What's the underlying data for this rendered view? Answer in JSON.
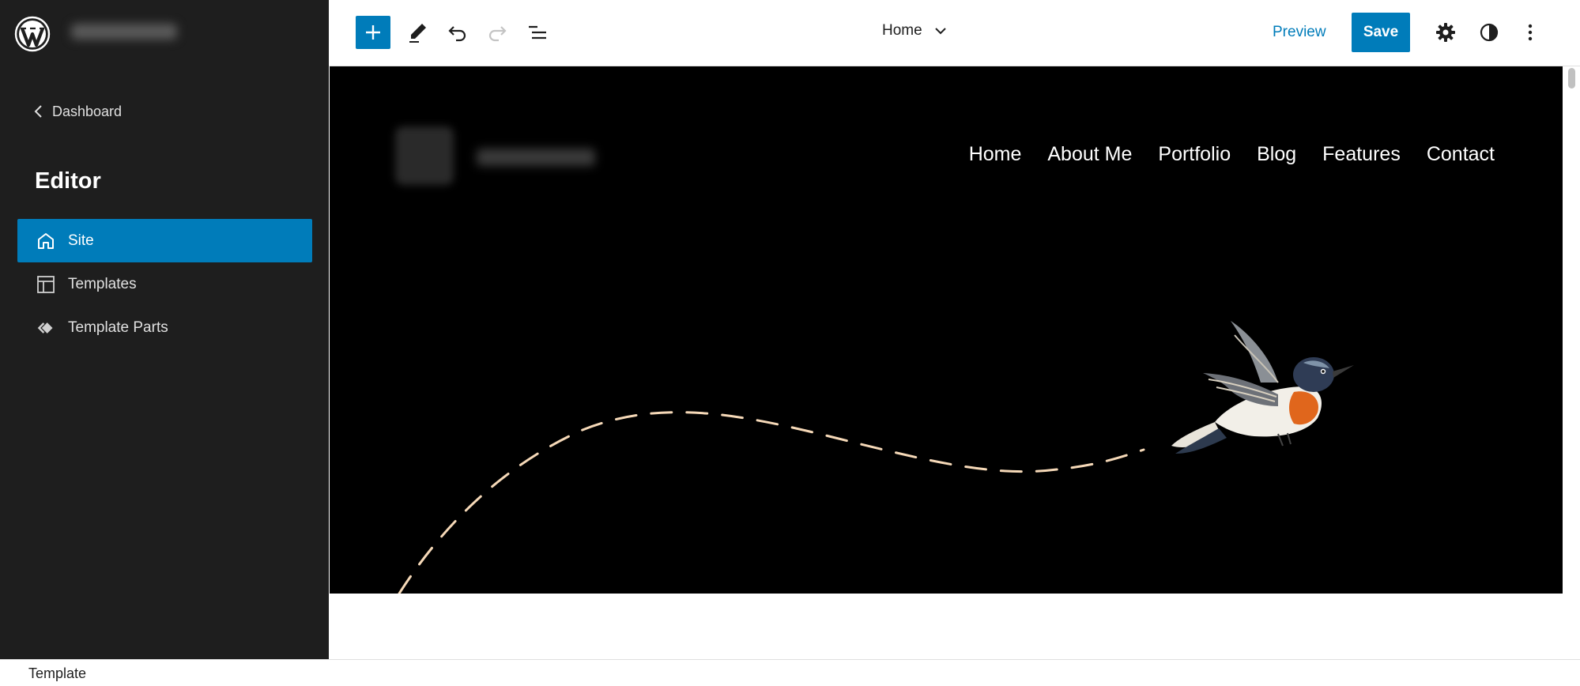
{
  "sidebar": {
    "back_label": "Dashboard",
    "section_title": "Editor",
    "items": [
      {
        "label": "Site",
        "icon": "home-icon",
        "active": true
      },
      {
        "label": "Templates",
        "icon": "layout-icon",
        "active": false
      },
      {
        "label": "Template Parts",
        "icon": "symbol-filled-icon",
        "active": false
      }
    ]
  },
  "toolbar": {
    "icons": [
      "plus-icon",
      "pencil-icon",
      "undo-icon",
      "redo-icon",
      "list-view-icon",
      "chevron-down-icon",
      "gear-icon",
      "contrast-icon",
      "more-vertical-icon"
    ],
    "document_title": "Home",
    "preview_label": "Preview",
    "save_label": "Save"
  },
  "site": {
    "nav": [
      "Home",
      "About Me",
      "Portfolio",
      "Blog",
      "Features",
      "Contact"
    ]
  },
  "footer": {
    "breadcrumb": "Template"
  },
  "colors": {
    "accent": "#007cba",
    "sidebar_bg": "#1e1e1e",
    "hero_bg": "#000000",
    "flight_path": "#f6d9b8"
  }
}
